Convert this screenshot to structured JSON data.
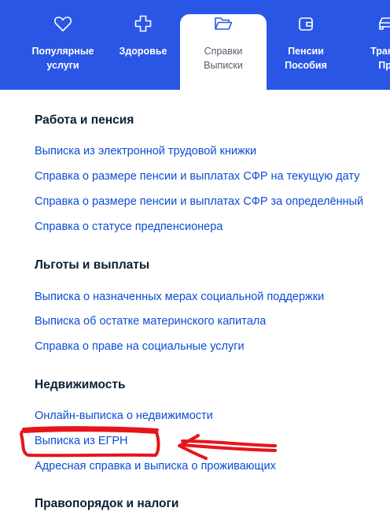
{
  "nav": {
    "categories": [
      {
        "line1": "Популярные",
        "line2": "услуги",
        "icon": "heart-icon",
        "active": false
      },
      {
        "line1": "Здоровье",
        "line2": "",
        "icon": "medical-cross-icon",
        "active": false
      },
      {
        "line1": "Справки",
        "line2": "Выписки",
        "icon": "folder-icon",
        "active": true
      },
      {
        "line1": "Пенсии",
        "line2": "Пособия",
        "icon": "wallet-icon",
        "active": false
      },
      {
        "line1": "Трансп",
        "line2": "Пра",
        "icon": "car-icon",
        "active": false
      }
    ]
  },
  "sections": [
    {
      "title": "Работа и пенсия",
      "links": [
        "Выписка из электронной трудовой книжки",
        "Справка о размере пенсии и выплатах СФР на текущую дату",
        "Справка о размере пенсии и выплатах СФР за определённый",
        "Справка о статусе предпенсионера"
      ]
    },
    {
      "title": "Льготы и выплаты",
      "links": [
        "Выписка о назначенных мерах социальной поддержки",
        "Выписка об остатке материнского капитала",
        "Справка о праве на социальные услуги"
      ]
    },
    {
      "title": "Недвижимость",
      "links": [
        "Онлайн-выписка о недвижимости",
        "Выписка из ЕГРН",
        "Адресная справка и выписка о проживающих"
      ]
    },
    {
      "title": "Правопорядок и налоги",
      "links": []
    }
  ],
  "colors": {
    "nav_bg": "#2a56e6",
    "link": "#0d4cd3",
    "heading": "#0b1f33",
    "annotation": "#e8141c"
  }
}
